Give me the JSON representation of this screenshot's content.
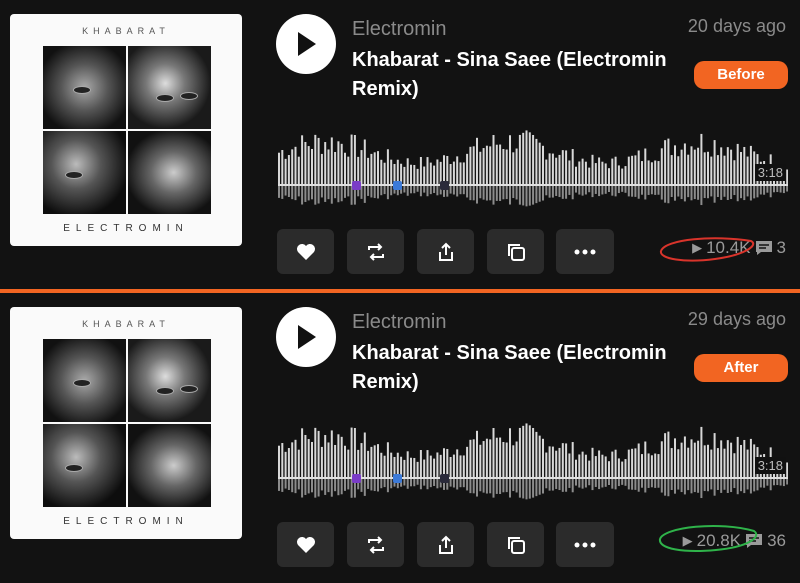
{
  "before": {
    "album_text_top": "KHABARAT",
    "album_text_bottom": "ELECTROMIN",
    "artist": "Electromin",
    "title": "Khabarat - Sina Saee (Electromin Remix)",
    "date": "20 days ago",
    "badge": "Before",
    "duration": "3:18",
    "plays": "10.4K",
    "comments": "3"
  },
  "after": {
    "album_text_top": "KHABARAT",
    "album_text_bottom": "ELECTROMIN",
    "artist": "Electromin",
    "title": "Khabarat - Sina Saee (Electromin Remix)",
    "date": "29 days ago",
    "badge": "After",
    "duration": "3:18",
    "plays": "20.8K",
    "comments": "36"
  },
  "colors": {
    "accent": "#f26522",
    "annotation_before": "#d9342b",
    "annotation_after": "#2fb34a"
  },
  "icons": [
    "play-icon",
    "heart-icon",
    "repost-icon",
    "share-icon",
    "copy-icon",
    "more-icon",
    "plays-icon",
    "comment-icon"
  ]
}
